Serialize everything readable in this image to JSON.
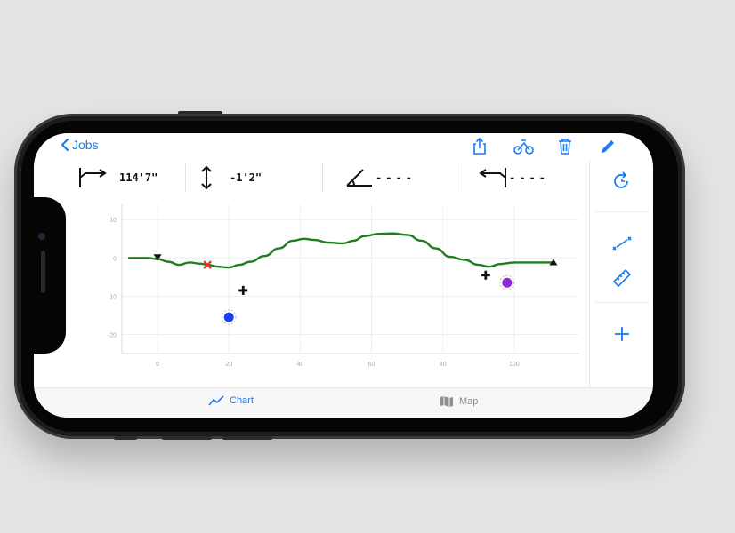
{
  "nav": {
    "back_label": "Jobs"
  },
  "metrics": [
    {
      "icon": "horizontal-distance-icon",
      "value": "114'7\""
    },
    {
      "icon": "vertical-distance-icon",
      "value": "-1'2\""
    },
    {
      "icon": "angle-icon",
      "value": "----"
    },
    {
      "icon": "slope-icon",
      "value": "----"
    }
  ],
  "chart_data": {
    "type": "line",
    "x_ticks": [
      "0",
      "20",
      "40",
      "60",
      "80",
      "100"
    ],
    "y_ticks": [
      "10",
      "0",
      "-10",
      "-20"
    ],
    "xlim": [
      -10,
      118
    ],
    "ylim": [
      -25,
      14
    ],
    "series": [
      {
        "color": "#1e7d1e",
        "x": [
          -8,
          -3,
          0,
          3,
          6,
          9,
          12,
          14,
          17,
          20,
          23,
          26,
          30,
          34,
          38,
          41,
          44,
          48,
          52,
          55,
          58,
          62,
          66,
          70,
          74,
          78,
          82,
          86,
          90,
          93,
          96,
          100,
          104,
          108,
          111
        ],
        "y": [
          0,
          0,
          -0.3,
          -1,
          -1.8,
          -1.2,
          -1.5,
          -1.8,
          -2.3,
          -2.5,
          -1.8,
          -1,
          0.5,
          2.5,
          4.5,
          5,
          4.7,
          4,
          3.8,
          4.5,
          5.7,
          6.3,
          6.4,
          6,
          4.5,
          2.5,
          0.3,
          -0.5,
          -1.8,
          -2.3,
          -1.6,
          -1.2,
          -1.2,
          -1.2,
          -1.2
        ]
      }
    ],
    "markers": [
      {
        "kind": "start-triangle-down",
        "x": 0,
        "y": 0,
        "color": "#111111"
      },
      {
        "kind": "x-cross",
        "x": 14,
        "y": -1.8,
        "color": "#e23b2e"
      },
      {
        "kind": "plus",
        "x": 24,
        "y": -8.5,
        "color": "#111111"
      },
      {
        "kind": "circle",
        "x": 20,
        "y": -15.5,
        "color": "#1a3ff0"
      },
      {
        "kind": "plus",
        "x": 92,
        "y": -4.5,
        "color": "#111111"
      },
      {
        "kind": "circle",
        "x": 98,
        "y": -6.5,
        "color": "#8b2ad8"
      },
      {
        "kind": "end-triangle-up",
        "x": 111,
        "y": -1.2,
        "color": "#111111"
      }
    ]
  },
  "tabs": [
    {
      "label": "Chart",
      "active": true
    },
    {
      "label": "Map",
      "active": false
    }
  ],
  "colors": {
    "accent": "#1a7bf2",
    "line": "#1e7d1e"
  }
}
